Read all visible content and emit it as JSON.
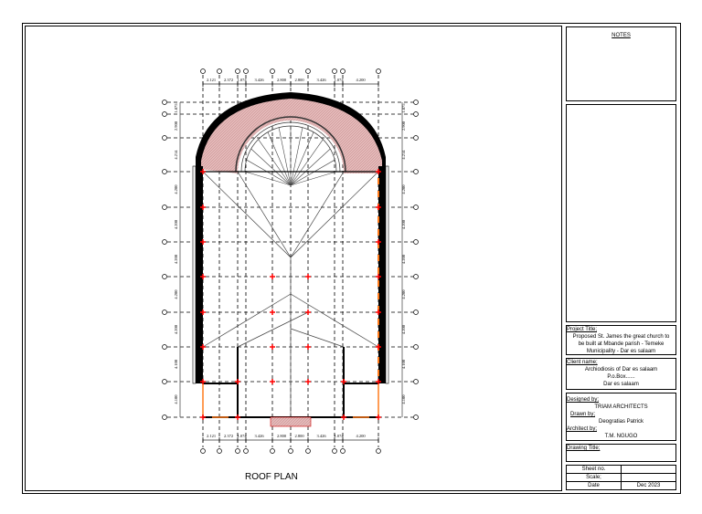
{
  "notes": {
    "heading": "NOTES"
  },
  "drawing": {
    "title": "ROOF PLAN",
    "horizontal_dimensions": [
      "2.121",
      "2.372",
      "1.074",
      "3.426",
      "2.800",
      "2.800",
      "3.426",
      "1.074",
      "4.200"
    ],
    "vertical_dimensions": [
      "1.875",
      "2.900",
      "4.214",
      "4.200",
      "4.200",
      "4.200",
      "4.200",
      "4.200",
      "4.100",
      "4.100"
    ]
  },
  "title_block": {
    "project_label": "Project Title;",
    "project_lines": [
      "Proposed St. James the great church to",
      "be built at Mbande parish - Temeke",
      "Municipality - Dar es salaam"
    ],
    "client_label": "Client name;",
    "client_lines": [
      "Archiodiosis of Dar es salaam",
      "P.o.Box......",
      "Dar es salaam"
    ],
    "designed_label": "Designed by;",
    "designed_value": "TRIAM ARCHITECTS",
    "drawn_label": "Drawn by;",
    "drawn_value": "Deogratias Patrick",
    "architect_label": "Architect by;",
    "architect_value": "T.M. NGUGO",
    "drawing_title_label": "Drawing Title;",
    "sheet_label": "Sheet no.",
    "sheet_value": "",
    "scale_label": "Scale;",
    "scale_value": "",
    "date_label": "Date",
    "date_value": "Dec 2023"
  },
  "colors": {
    "hatch": "#d9a5a5",
    "column": "#ff0000",
    "opening": "#ff7a1a",
    "wall": "#000000"
  }
}
